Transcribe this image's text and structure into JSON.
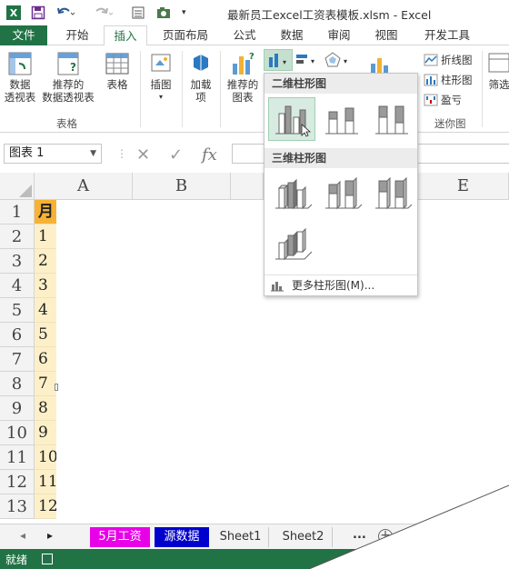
{
  "titlebar": {
    "title": "最新员工excel工资表模板.xlsm - Excel",
    "icons": [
      "excel-logo-icon",
      "save-icon",
      "undo-icon",
      "redo-icon",
      "form-icon",
      "camera-icon"
    ]
  },
  "ribbon_tabs": [
    "文件",
    "开始",
    "插入",
    "页面布局",
    "公式",
    "数据",
    "审阅",
    "视图",
    "开发工具"
  ],
  "ribbon": {
    "pivot_table": "数据\n透视表",
    "recommended_pivot": "推荐的\n数据透视表",
    "table": "表格",
    "tables_group": "表格",
    "illustrations": "插图",
    "addins": "加载\n项",
    "recommended_charts": "推荐的\n图表",
    "sparkline_line": "折线图",
    "sparkline_column": "柱形图",
    "sparkline_winloss": "盈亏",
    "sparklines_group": "迷你图",
    "filter": "筛选"
  },
  "formula_bar": {
    "name_box": "图表 1",
    "fx": "fx"
  },
  "columns": [
    "A",
    "B",
    "E"
  ],
  "rows": [
    "1",
    "2",
    "3",
    "4",
    "5",
    "6",
    "7",
    "8",
    "9",
    "10",
    "11",
    "12",
    "13"
  ],
  "cells_A": [
    "月",
    "1",
    "2",
    "3",
    "4",
    "5",
    "6",
    "7",
    "8",
    "9",
    "10",
    "11",
    "12"
  ],
  "dropdown": {
    "header_2d": "二维柱形图",
    "header_3d": "三维柱形图",
    "more": "更多柱形图(M)..."
  },
  "sheets": [
    "5月工资",
    "源数据",
    "Sheet1",
    "Sheet2"
  ],
  "sheet_more": "...",
  "status": "就绪",
  "colors": {
    "excel_green": "#217346",
    "header_orange": "#f7b235",
    "cell_cream": "#fdf0c9",
    "sheet_magenta": "#e800e8",
    "sheet_blue": "#0000cc"
  }
}
